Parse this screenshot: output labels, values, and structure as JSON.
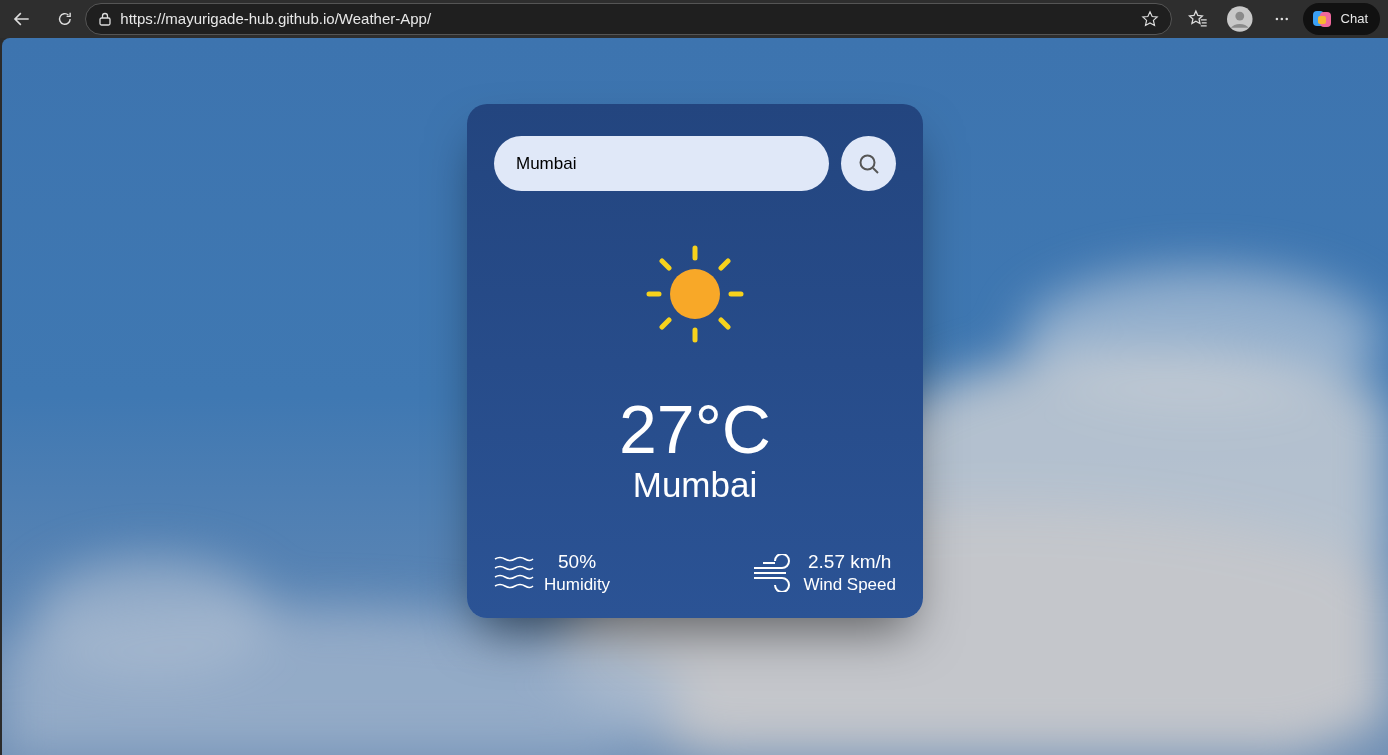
{
  "browser": {
    "url": "https://mayurigade-hub.github.io/Weather-App/",
    "chat_label": "Chat"
  },
  "search": {
    "value": "Mumbai"
  },
  "weather": {
    "temperature": "27°C",
    "city": "Mumbai"
  },
  "stats": [
    {
      "kind": "humidity",
      "value": "50%",
      "label": "Humidity"
    },
    {
      "kind": "wind",
      "value": "2.57 km/h",
      "label": "Wind Speed"
    }
  ]
}
